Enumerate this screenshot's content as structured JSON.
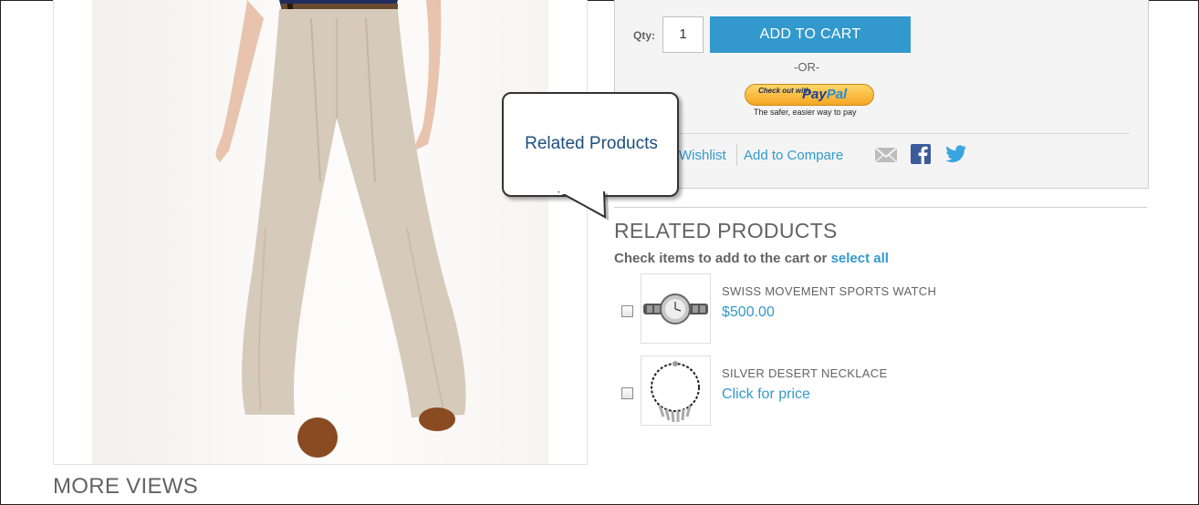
{
  "product": {
    "image_alt": "Wide-leg pleated trousers",
    "more_views": "MORE VIEWS"
  },
  "cart": {
    "qty_label": "Qty:",
    "qty_value": "1",
    "add_to_cart": "ADD TO CART",
    "or_text": "-OR-",
    "paypal": {
      "checkout_text": "Check out with",
      "pay": "Pay",
      "pal": "Pal",
      "tagline": "The safer, easier way to pay"
    },
    "wishlist": "Wishlist",
    "compare": "Add to Compare",
    "share_icons": [
      "email-icon",
      "facebook-icon",
      "twitter-icon"
    ]
  },
  "callout": {
    "text": "Related Products"
  },
  "related": {
    "title": "RELATED PRODUCTS",
    "instruction": "Check items to add to the cart or",
    "select_all": "select all",
    "items": [
      {
        "name": "SWISS MOVEMENT SPORTS WATCH",
        "price": "$500.00",
        "checked": false
      },
      {
        "name": "SILVER DESERT NECKLACE",
        "price": "Click for price",
        "checked": false
      }
    ]
  },
  "colors": {
    "accent": "#3399cc",
    "panel_bg": "#f4f4f4",
    "text": "#636363",
    "callout_text": "#1e4f7e"
  }
}
